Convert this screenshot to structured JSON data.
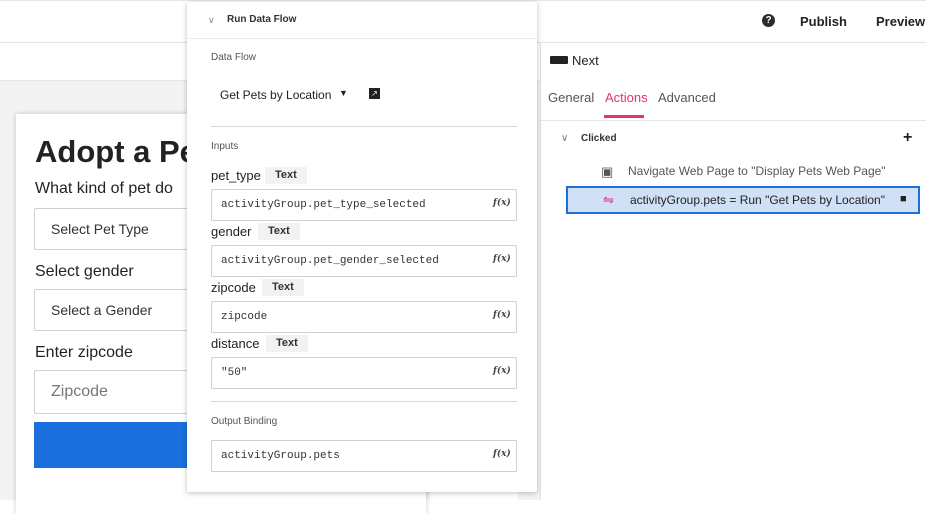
{
  "toolbar": {
    "help_icon": "help-circle-icon",
    "publish_label": "Publish",
    "preview_label": "Preview"
  },
  "form": {
    "title": "Adopt a Pe",
    "pet_question": "What kind of pet do",
    "pet_select": "Select Pet Type",
    "gender_label": "Select gender",
    "gender_select": "Select a Gender",
    "zip_label": "Enter zipcode",
    "zip_placeholder": "Zipcode"
  },
  "panel": {
    "component_name": "Next",
    "tabs": [
      {
        "label": "General"
      },
      {
        "label": "Actions"
      },
      {
        "label": "Advanced"
      }
    ],
    "event_label": "Clicked",
    "actions": [
      {
        "label": "Navigate Web Page to \"Display Pets Web Page\""
      },
      {
        "label": "activityGroup.pets = Run \"Get Pets by Location\""
      }
    ]
  },
  "popup": {
    "title": "Run Data Flow",
    "dataflow_section": "Data Flow",
    "dataflow_value": "Get Pets by Location",
    "inputs_section": "Inputs",
    "inputs": [
      {
        "name": "pet_type",
        "type": "Text",
        "value": "activityGroup.pet_type_selected"
      },
      {
        "name": "gender",
        "type": "Text",
        "value": "activityGroup.pet_gender_selected"
      },
      {
        "name": "zipcode",
        "type": "Text",
        "value": "zipcode"
      },
      {
        "name": "distance",
        "type": "Text",
        "value": "\"50\""
      }
    ],
    "output_section": "Output Binding",
    "output_value": "activityGroup.pets"
  },
  "colors": {
    "accent": "#e0366b",
    "primary": "#1a6fdc",
    "selected_bg": "#cfe0f7"
  }
}
